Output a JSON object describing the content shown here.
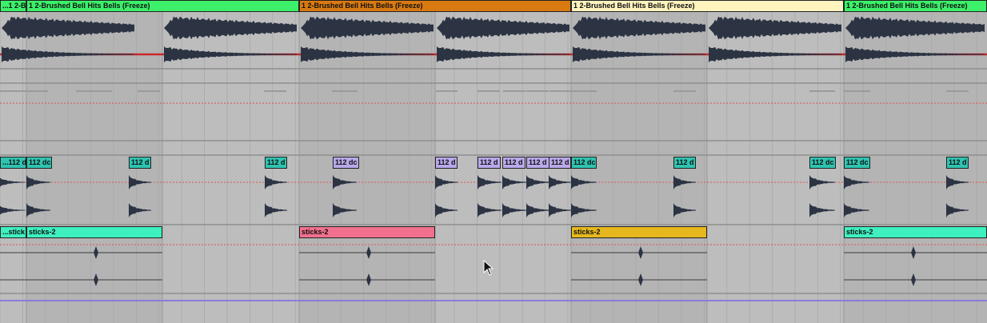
{
  "lanes": {
    "bells": {
      "color": "#3cf06a",
      "clips": [
        {
          "label": "...1 2-B",
          "color": "#3cf06a"
        },
        {
          "label": "1 2-Brushed Bell Hits Bells (Freeze)",
          "color": "#3cf06a"
        },
        {
          "label": "1 2-Brushed Bell Hits Bells (Freeze)",
          "color": "#d97a10"
        },
        {
          "label": "1 2-Brushed Bell Hits Bells (Freeze)",
          "color": "#fff3be"
        },
        {
          "label": "1 2-Brushed Bell Hits Bells (Freeze)",
          "color": "#3cf06a"
        }
      ]
    },
    "hits": {
      "clips": [
        {
          "label": "...112 d",
          "color": "#2ec4b0"
        },
        {
          "label": "112 dc",
          "color": "#2ec4b0"
        },
        {
          "label": "112 d",
          "color": "#2ec4b0"
        },
        {
          "label": "112 d",
          "color": "#2ec4b0"
        },
        {
          "label": "112 dc",
          "color": "#b9a8ea"
        },
        {
          "label": "112 d",
          "color": "#b9a8ea"
        },
        {
          "label": "112 d",
          "color": "#b9a8ea"
        },
        {
          "label": "112 d",
          "color": "#b9a8ea"
        },
        {
          "label": "112 d",
          "color": "#b9a8ea"
        },
        {
          "label": "112 d",
          "color": "#b9a8ea"
        },
        {
          "label": "112 dc",
          "color": "#2ec4b0"
        },
        {
          "label": "112 d",
          "color": "#2ec4b0"
        },
        {
          "label": "112 dc",
          "color": "#2ec4b0"
        },
        {
          "label": "112 dc",
          "color": "#2ec4b0"
        },
        {
          "label": "112 d",
          "color": "#2ec4b0"
        }
      ]
    },
    "sticks": {
      "clips": [
        {
          "label": "...stick",
          "color": "#3ef0c0"
        },
        {
          "label": "sticks-2",
          "color": "#3ef0c0"
        },
        {
          "label": "sticks-2",
          "color": "#f0708e"
        },
        {
          "label": "sticks-2",
          "color": "#e6b81e"
        },
        {
          "label": "sticks-2",
          "color": "#3ef0c0"
        }
      ]
    }
  },
  "colors": {
    "background": "#b4b4b4",
    "loop_region": "#bdbdbd",
    "waveform": "#2c3444",
    "automation_red": "#c8282a",
    "automation_purple": "#8c7cd8",
    "dotted_red": "#e05050"
  },
  "icons": {
    "cursor": "mouse-pointer-icon"
  }
}
